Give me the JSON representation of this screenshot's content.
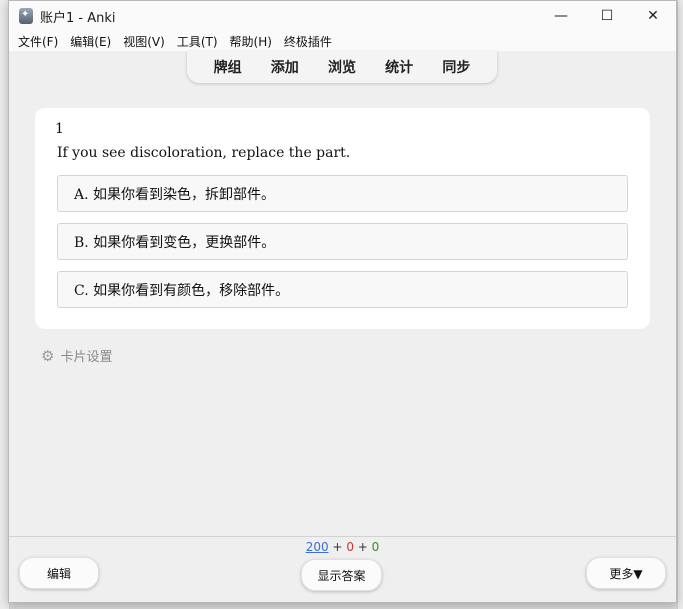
{
  "window": {
    "title": "账户1 - Anki",
    "controls": {
      "minimize": "—",
      "maximize": "☐",
      "close": "✕"
    }
  },
  "menu": {
    "items": [
      "文件(F)",
      "编辑(E)",
      "视图(V)",
      "工具(T)",
      "帮助(H)",
      "终极插件"
    ]
  },
  "topnav": {
    "items": [
      "牌组",
      "添加",
      "浏览",
      "统计",
      "同步"
    ]
  },
  "card": {
    "number": "1",
    "question": "If you see discoloration, replace the part.",
    "options": [
      "A. 如果你看到染色，拆卸部件。",
      "B. 如果你看到变色，更换部件。",
      "C. 如果你看到有颜色，移除部件。"
    ]
  },
  "card_settings": {
    "label": "卡片设置",
    "icon": "gear-icon"
  },
  "counts": {
    "new": "200",
    "learn": "0",
    "review": "0",
    "sep": "+"
  },
  "bottom": {
    "edit_label": "编辑",
    "show_answer_label": "显示答案",
    "more_label": "更多▼"
  },
  "colors": {
    "new": "#3b6fd6",
    "learn": "#c8382d",
    "review": "#2f8f2f"
  }
}
